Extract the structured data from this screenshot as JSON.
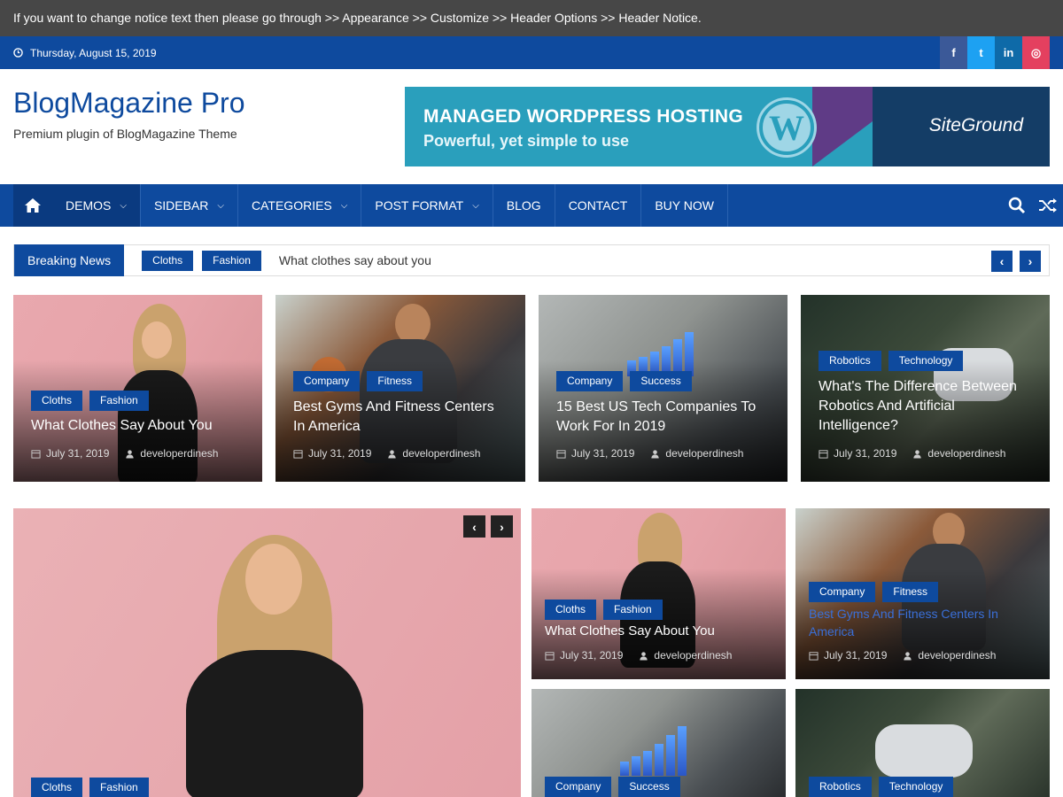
{
  "notice": "If you want to change notice text then please go through >> Appearance >> Customize >> Header Options >> Header Notice.",
  "date": "Thursday, August 15, 2019",
  "social": [
    {
      "icon": "facebook-icon",
      "glyph": "f",
      "color": "#3b5998"
    },
    {
      "icon": "twitter-icon",
      "glyph": "t",
      "color": "#1da1f2"
    },
    {
      "icon": "linkedin-icon",
      "glyph": "in",
      "color": "#0e6aa8"
    },
    {
      "icon": "instagram-icon",
      "glyph": "◎",
      "color": "#e4405f"
    }
  ],
  "site": {
    "title": "BlogMagazine Pro",
    "description": "Premium plugin of BlogMagazine Theme"
  },
  "banner": {
    "headline": "MANAGED WORDPRESS HOSTING",
    "subline": "Powerful, yet simple to use",
    "brand": "SiteGround"
  },
  "nav": {
    "items": [
      {
        "label": "DEMOS"
      },
      {
        "label": "SIDEBAR"
      },
      {
        "label": "CATEGORIES"
      },
      {
        "label": "POST FORMAT"
      },
      {
        "label": "BLOG"
      },
      {
        "label": "CONTACT"
      },
      {
        "label": "BUY NOW"
      }
    ]
  },
  "ticker": {
    "label": "Breaking News",
    "tags": [
      "Cloths",
      "Fashion"
    ],
    "text": "What clothes say about you"
  },
  "featured": [
    {
      "tags": [
        "Cloths",
        "Fashion"
      ],
      "title": "What Clothes Say About You",
      "date": "July 31, 2019",
      "author": "developerdinesh"
    },
    {
      "tags": [
        "Company",
        "Fitness"
      ],
      "title": "Best Gyms And Fitness Centers In America",
      "date": "July 31, 2019",
      "author": "developerdinesh"
    },
    {
      "tags": [
        "Company",
        "Success"
      ],
      "title": "15 Best US Tech Companies To Work For In 2019",
      "date": "July 31, 2019",
      "author": "developerdinesh"
    },
    {
      "tags": [
        "Robotics",
        "Technology"
      ],
      "title": "What's The Difference Between Robotics And Artificial Intelligence?",
      "date": "July 31, 2019",
      "author": "developerdinesh"
    }
  ],
  "slider": {
    "tags": [
      "Cloths",
      "Fashion"
    ]
  },
  "grid": [
    {
      "tags": [
        "Cloths",
        "Fashion"
      ],
      "title": "What Clothes Say About You",
      "date": "July 31, 2019",
      "author": "developerdinesh"
    },
    {
      "tags": [
        "Company",
        "Fitness"
      ],
      "title": "Best Gyms And Fitness Centers In America",
      "date": "July 31, 2019",
      "author": "developerdinesh"
    },
    {
      "tags": [
        "Company",
        "Success"
      ]
    },
    {
      "tags": [
        "Robotics",
        "Technology"
      ]
    }
  ],
  "colors": {
    "primary": "#0e4a9e",
    "notice_bg": "#474747",
    "highlight_title": "#3a6fd8"
  }
}
